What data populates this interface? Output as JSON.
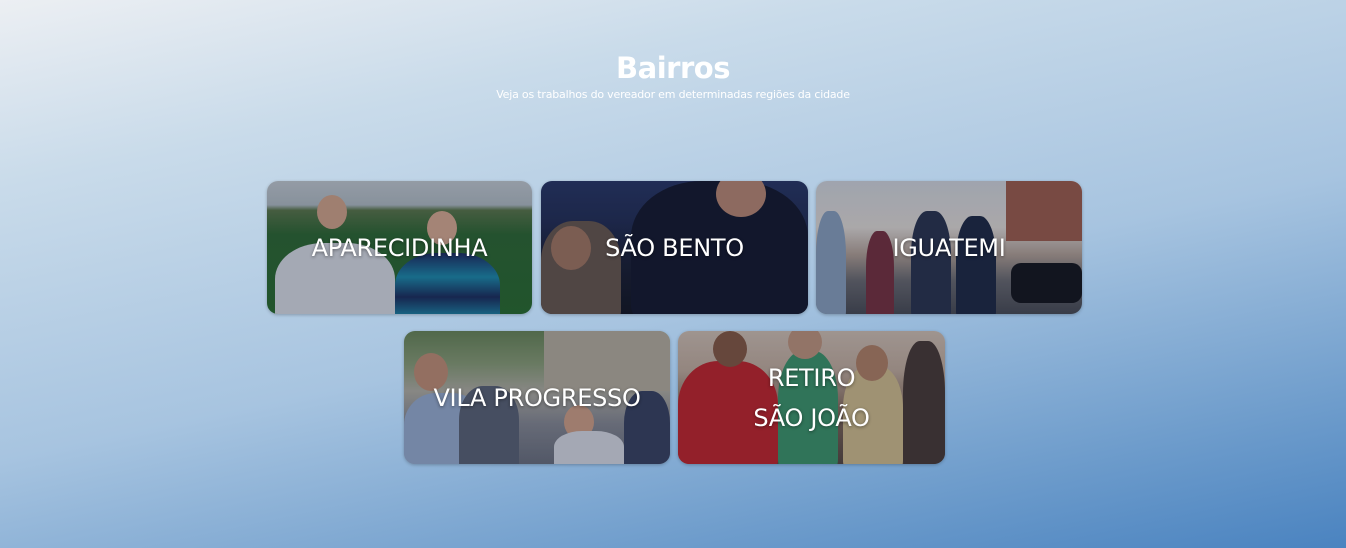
{
  "section": {
    "title": "Bairros",
    "subtitle": "Veja os trabalhos do vereador em determinadas regiões da cidade"
  },
  "neighborhoods": [
    {
      "name": "APARECIDINHA"
    },
    {
      "name": "SÃO BENTO"
    },
    {
      "name": "IGUATEMI"
    },
    {
      "name": "VILA PROGRESSO"
    },
    {
      "name": "RETIRO\nSÃO JOÃO"
    }
  ]
}
